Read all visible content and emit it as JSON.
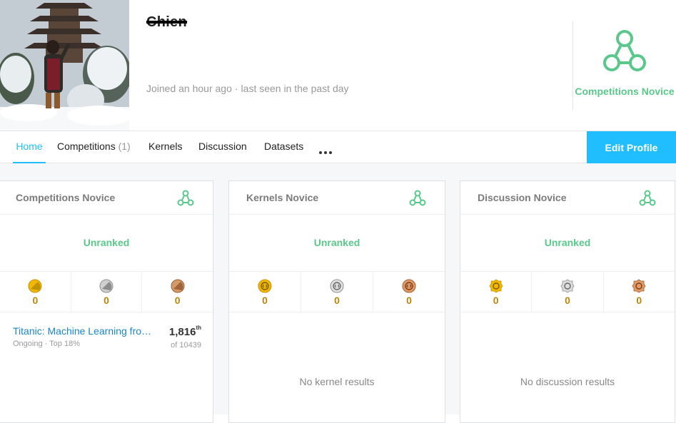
{
  "profile": {
    "name": "Chien",
    "joined": "Joined an hour ago",
    "separator": "·",
    "last_seen": "last seen in the past day",
    "tier": "Competitions Novice",
    "tier_color": "#5ac88b"
  },
  "tabs": [
    {
      "label": "Home",
      "active": true
    },
    {
      "label": "Competitions",
      "count": "(1)"
    },
    {
      "label": "Kernels"
    },
    {
      "label": "Discussion"
    },
    {
      "label": "Datasets"
    }
  ],
  "edit_button": "Edit Profile",
  "colors": {
    "accent": "#20beff",
    "novice": "#5ac88b",
    "gold": "#d4a017",
    "silver": "#9a9a9a",
    "bronze": "#b0734a"
  },
  "cards": [
    {
      "title": "Competitions Novice",
      "rank": "Unranked",
      "medals": {
        "gold": "0",
        "silver": "0",
        "bronze": "0"
      },
      "competition": {
        "name": "Titanic: Machine Learning from Disaster",
        "status": "Ongoing · Top 18%",
        "rank": "1,816",
        "rank_suffix": "th",
        "of": "of 10439"
      }
    },
    {
      "title": "Kernels Novice",
      "rank": "Unranked",
      "medals": {
        "gold": "0",
        "silver": "0",
        "bronze": "0"
      },
      "empty": "No kernel results"
    },
    {
      "title": "Discussion Novice",
      "rank": "Unranked",
      "medals": {
        "gold": "0",
        "silver": "0",
        "bronze": "0"
      },
      "empty": "No discussion results"
    }
  ]
}
